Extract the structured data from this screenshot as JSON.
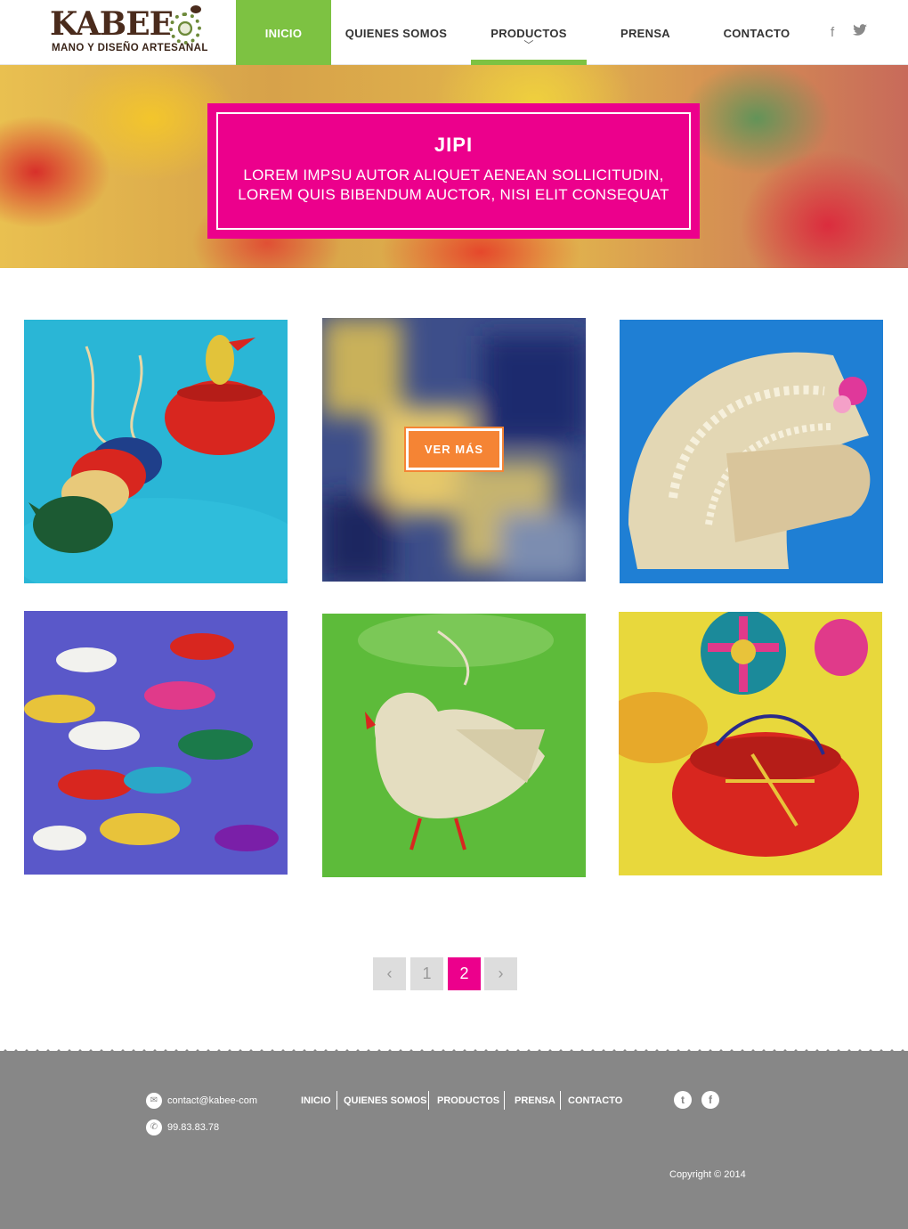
{
  "brand": {
    "name": "KABEE",
    "tagline": "MANO Y DISEÑO ARTESANAL"
  },
  "nav": {
    "items": [
      {
        "label": "INICIO",
        "state": "active"
      },
      {
        "label": "QUIENES SOMOS",
        "state": "normal"
      },
      {
        "label": "PRODUCTOS",
        "state": "current"
      },
      {
        "label": "PRENSA",
        "state": "normal"
      },
      {
        "label": "CONTACTO",
        "state": "normal"
      }
    ],
    "social": [
      {
        "icon": "facebook-icon",
        "glyph": "f"
      },
      {
        "icon": "twitter-icon",
        "glyph": "t"
      }
    ]
  },
  "hero": {
    "title": "JIPI",
    "text_line1": "LOREM IMPSU AUTOR ALIQUET AENEAN SOLLICITUDIN,",
    "text_line2": "LOREM QUIS BIBENDUM AUCTOR, NISI ELIT CONSEQUAT"
  },
  "products": [
    {
      "name": "woven-birds-and-basket"
    },
    {
      "name": "blurred-product",
      "overlay_button": "VER MÁS"
    },
    {
      "name": "woven-fan"
    },
    {
      "name": "woven-fish"
    },
    {
      "name": "woven-dove"
    },
    {
      "name": "colorful-baskets"
    }
  ],
  "pagination": {
    "prev_glyph": "‹",
    "next_glyph": "›",
    "pages": [
      "1",
      "2"
    ],
    "current_page": "2"
  },
  "footer": {
    "email": "contact@kabee-com",
    "phone": "99.83.83.78",
    "nav": [
      "INICIO",
      "QUIENES SOMOS",
      "PRODUCTOS",
      "PRENSA",
      "CONTACTO"
    ],
    "social_glyphs": {
      "twitter": "t",
      "facebook": "f"
    },
    "copyright": "Copyright © 2014"
  },
  "colors": {
    "accent_green": "#7dc242",
    "accent_pink": "#ec008c",
    "accent_orange": "#f58434",
    "footer_gray": "#878787"
  }
}
